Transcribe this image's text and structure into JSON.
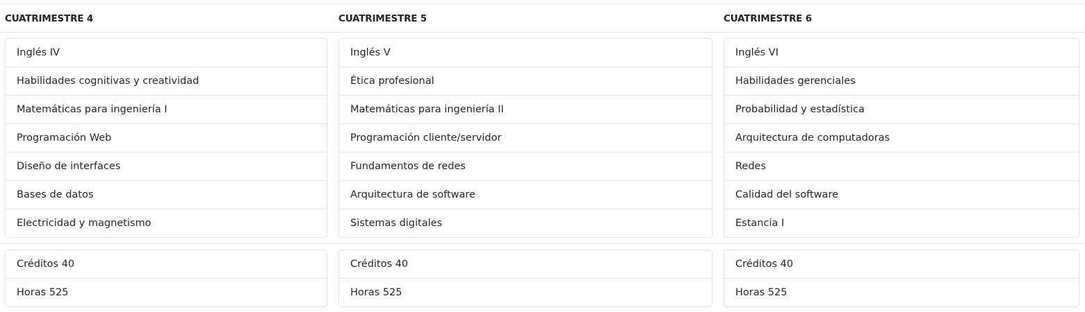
{
  "columns": [
    {
      "title": "CUATRIMESTRE 4",
      "courses": [
        "Inglés IV",
        "Habilidades cognitivas y creatividad",
        "Matemáticas para ingeniería I",
        "Programación Web",
        "Diseño de interfaces",
        "Bases de datos",
        "Electricidad y magnetismo"
      ],
      "creditos": "Créditos 40",
      "horas": "Horas 525"
    },
    {
      "title": "CUATRIMESTRE 5",
      "courses": [
        "Inglés V",
        "Ética profesional",
        "Matemáticas para ingeniería II",
        "Programación cliente/servidor",
        "Fundamentos de redes",
        "Arquitectura de software",
        "Sistemas digitales"
      ],
      "creditos": "Créditos 40",
      "horas": "Horas 525"
    },
    {
      "title": "CUATRIMESTRE 6",
      "courses": [
        "Inglés VI",
        "Habilidades gerenciales",
        "Probabilidad y estadística",
        "Arquitectura de computadoras",
        "Redes",
        "Calidad del software",
        "Estancia I"
      ],
      "creditos": "Créditos 40",
      "horas": "Horas 525"
    }
  ]
}
